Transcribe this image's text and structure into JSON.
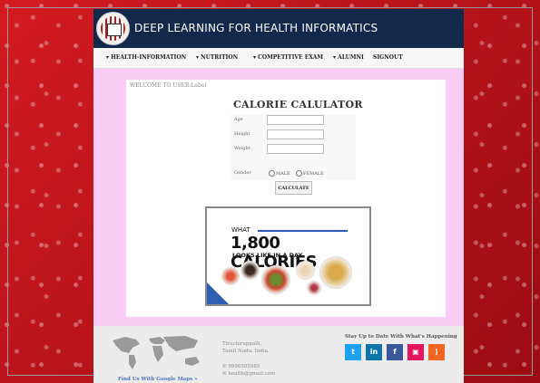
{
  "site": {
    "title": "DEEP LEARNING FOR HEALTH INFORMATICS"
  },
  "nav": {
    "items": [
      "▾ HEALTH-INFORMATION",
      "▾ NUTRITION",
      "▾ COMPETITIVE EXAM",
      "▾ ALUMNI",
      "SIGNOUT"
    ]
  },
  "welcome": "WELCOME TO USER:Label",
  "calculator": {
    "title": "CALORIE CALULATOR",
    "fields": {
      "age": "Age",
      "height": "Height",
      "weight": "Weight",
      "gender": "Gender"
    },
    "gender_options": [
      "MALE",
      "FEMALE"
    ],
    "button": "CALCULATE"
  },
  "promo": {
    "line1": "WHAT",
    "line2": "1,800 CALORIES",
    "line3": "LOOKS LIKE IN A DAY"
  },
  "footer": {
    "map_link": "Find Us With Google Maps »",
    "city": "Tiruchirappalli,",
    "state": "Tamil Nadu, India.",
    "phone": "9998585585",
    "email": "health@gmail.com",
    "social_title": "Stay Up to Date With What's Happening",
    "social": [
      {
        "name": "twitter-icon",
        "glyph": "t",
        "color": "#1da1f2"
      },
      {
        "name": "linkedin-icon",
        "glyph": "in",
        "color": "#0e76a8"
      },
      {
        "name": "facebook-icon",
        "glyph": "f",
        "color": "#3b5998"
      },
      {
        "name": "instagram-icon",
        "glyph": "▣",
        "color": "#e4145e"
      },
      {
        "name": "rss-icon",
        "glyph": ")",
        "color": "#f26522"
      }
    ]
  }
}
